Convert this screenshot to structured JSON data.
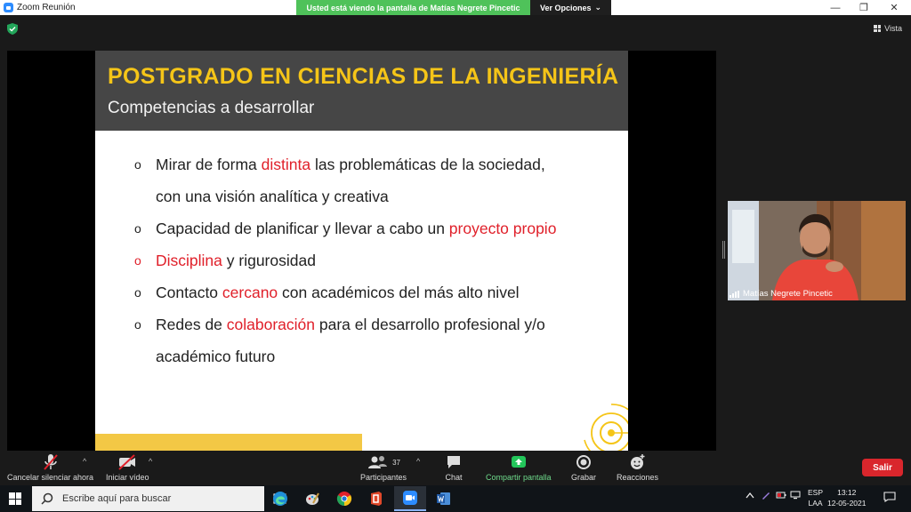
{
  "window": {
    "title": "Zoom Reunión",
    "minimize": "—",
    "restore": "❐",
    "close": "✕"
  },
  "share_banner": {
    "text": "Usted está viendo la pantalla de Matías Negrete Pincetic",
    "options_label": "Ver Opciones",
    "options_caret": "⌄"
  },
  "view": {
    "label": "Vista"
  },
  "slide": {
    "title": "POSTGRADO EN CIENCIAS DE LA INGENIERÍA",
    "subtitle": "Competencias a desarrollar",
    "bullet_marker": "o",
    "bullets": {
      "b1": {
        "before": "Mirar de forma ",
        "highlight": "distinta",
        "after": " las problemáticas de la sociedad,",
        "cont": "con una visión analítica y creativa"
      },
      "b2": {
        "before": "Capacidad de planificar y llevar a cabo un ",
        "highlight": "proyecto propio"
      },
      "b3": {
        "highlight": "Disciplina",
        "after": " y rigurosidad"
      },
      "b4": {
        "before": "Contacto ",
        "highlight": "cercano",
        "after": " con académicos del más alto nivel"
      },
      "b5": {
        "before": "Redes de ",
        "highlight": "colaboración",
        "after": " para el desarrollo profesional y/o",
        "cont": "académico futuro"
      }
    }
  },
  "participant": {
    "name": "Matías Negrete Pincetic"
  },
  "toolbar": {
    "mute_label": "Cancelar silenciar ahora",
    "video_label": "Iniciar vídeo",
    "participants_label": "Participantes",
    "participants_count": "37",
    "chat_label": "Chat",
    "share_label": "Compartir pantalla",
    "record_label": "Grabar",
    "reactions_label": "Reacciones",
    "leave_label": "Salir",
    "caret": "^"
  },
  "taskbar": {
    "search_placeholder": "Escribe aquí para buscar",
    "lang_top": "ESP",
    "lang_bottom": "LAA",
    "time": "13:12",
    "date": "12-05-2021"
  },
  "colors": {
    "accent_yellow": "#f5c518",
    "highlight_red": "#e0202a",
    "zoom_green": "#4fc25a",
    "leave_red": "#d9262c"
  }
}
